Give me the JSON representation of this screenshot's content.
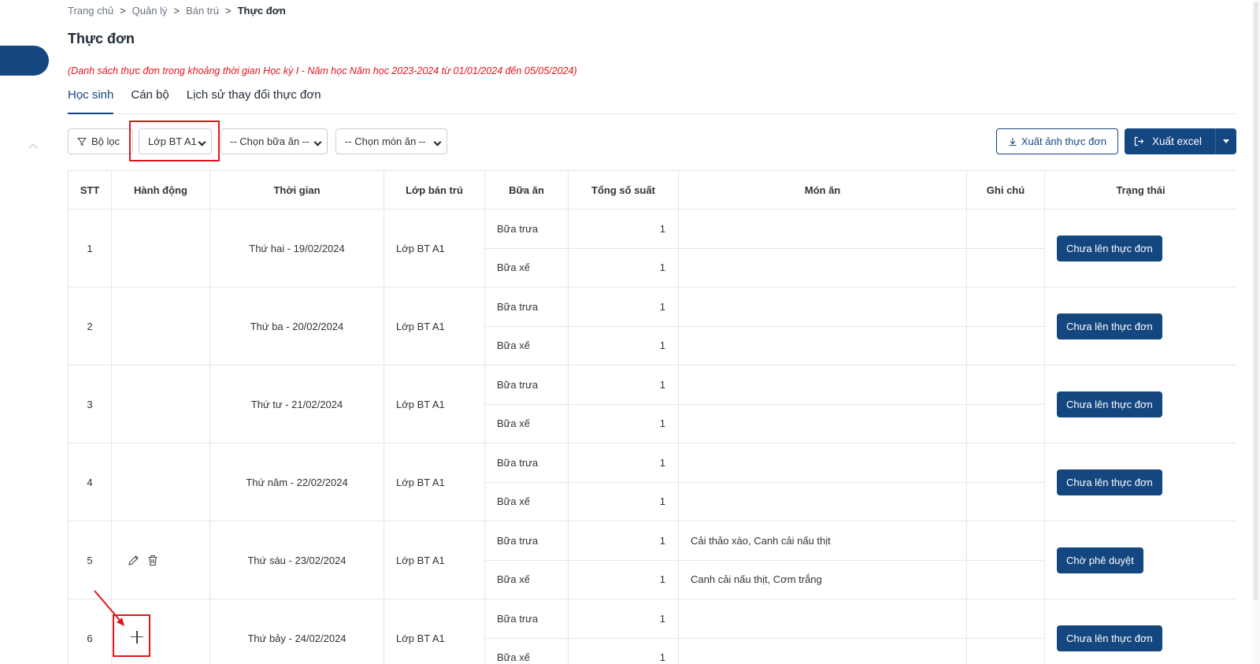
{
  "breadcrumb": {
    "items": [
      "Trang chủ",
      "Quản lý",
      "Bán trú"
    ],
    "current": "Thực đơn",
    "separator": ">"
  },
  "page": {
    "title": "Thực đơn",
    "subtitle": "(Danh sách thực đơn trong khoảng thời gian Học kỳ I - Năm học Năm học 2023-2024 từ 01/01/2024 đến 05/05/2024)"
  },
  "tabs": [
    {
      "label": "Học sinh",
      "active": true
    },
    {
      "label": "Cán bộ",
      "active": false
    },
    {
      "label": "Lịch sử thay đổi thực đơn",
      "active": false
    }
  ],
  "toolbar": {
    "filter_label": "Bộ lọc",
    "class_select": "Lớp BT A1",
    "meal_select": "-- Chọn bữa ăn --",
    "dish_select": "-- Chọn món ăn --",
    "export_image_label": "Xuất ảnh thực đơn",
    "export_excel_label": "Xuất excel"
  },
  "table": {
    "headers": [
      "STT",
      "Hành động",
      "Thời gian",
      "Lớp bán trú",
      "Bữa ăn",
      "Tổng số suất",
      "Món ăn",
      "Ghi chú",
      "Trạng thái"
    ],
    "rows": [
      {
        "stt": "1",
        "date": "Thứ hai - 19/02/2024",
        "class": "Lớp BT A1",
        "status": "Chưa lên thực đơn",
        "actions": "none",
        "meals": [
          {
            "meal": "Bữa trưa",
            "qty": "1",
            "dish": "",
            "note": ""
          },
          {
            "meal": "Bữa xế",
            "qty": "1",
            "dish": "",
            "note": ""
          }
        ]
      },
      {
        "stt": "2",
        "date": "Thứ ba - 20/02/2024",
        "class": "Lớp BT A1",
        "status": "Chưa lên thực đơn",
        "actions": "none",
        "meals": [
          {
            "meal": "Bữa trưa",
            "qty": "1",
            "dish": "",
            "note": ""
          },
          {
            "meal": "Bữa xế",
            "qty": "1",
            "dish": "",
            "note": ""
          }
        ]
      },
      {
        "stt": "3",
        "date": "Thứ tư - 21/02/2024",
        "class": "Lớp BT A1",
        "status": "Chưa lên thực đơn",
        "actions": "none",
        "meals": [
          {
            "meal": "Bữa trưa",
            "qty": "1",
            "dish": "",
            "note": ""
          },
          {
            "meal": "Bữa xế",
            "qty": "1",
            "dish": "",
            "note": ""
          }
        ]
      },
      {
        "stt": "4",
        "date": "Thứ năm - 22/02/2024",
        "class": "Lớp BT A1",
        "status": "Chưa lên thực đơn",
        "actions": "none",
        "meals": [
          {
            "meal": "Bữa trưa",
            "qty": "1",
            "dish": "",
            "note": ""
          },
          {
            "meal": "Bữa xế",
            "qty": "1",
            "dish": "",
            "note": ""
          }
        ]
      },
      {
        "stt": "5",
        "date": "Thứ sáu - 23/02/2024",
        "class": "Lớp BT A1",
        "status": "Chờ phê duyệt",
        "actions": "edit-delete",
        "meals": [
          {
            "meal": "Bữa trưa",
            "qty": "1",
            "dish": "Cải thảo xào, Canh cải nấu thịt",
            "note": ""
          },
          {
            "meal": "Bữa xế",
            "qty": "1",
            "dish": "Canh cải nấu thịt, Cơm trắng",
            "note": ""
          }
        ]
      },
      {
        "stt": "6",
        "date": "Thứ bảy - 24/02/2024",
        "class": "Lớp BT A1",
        "status": "Chưa lên thực đơn",
        "actions": "add",
        "meals": [
          {
            "meal": "Bữa trưa",
            "qty": "1",
            "dish": "",
            "note": ""
          },
          {
            "meal": "Bữa xế",
            "qty": "1",
            "dish": "",
            "note": ""
          }
        ]
      }
    ]
  },
  "icons": {
    "filter": "filter-icon",
    "download": "download-icon",
    "export": "export-icon",
    "edit": "pencil-icon",
    "delete": "trash-icon",
    "add": "plus-icon"
  },
  "colors": {
    "primary": "#14467f",
    "highlight": "#e0161e",
    "subtitle": "#e2151d"
  }
}
